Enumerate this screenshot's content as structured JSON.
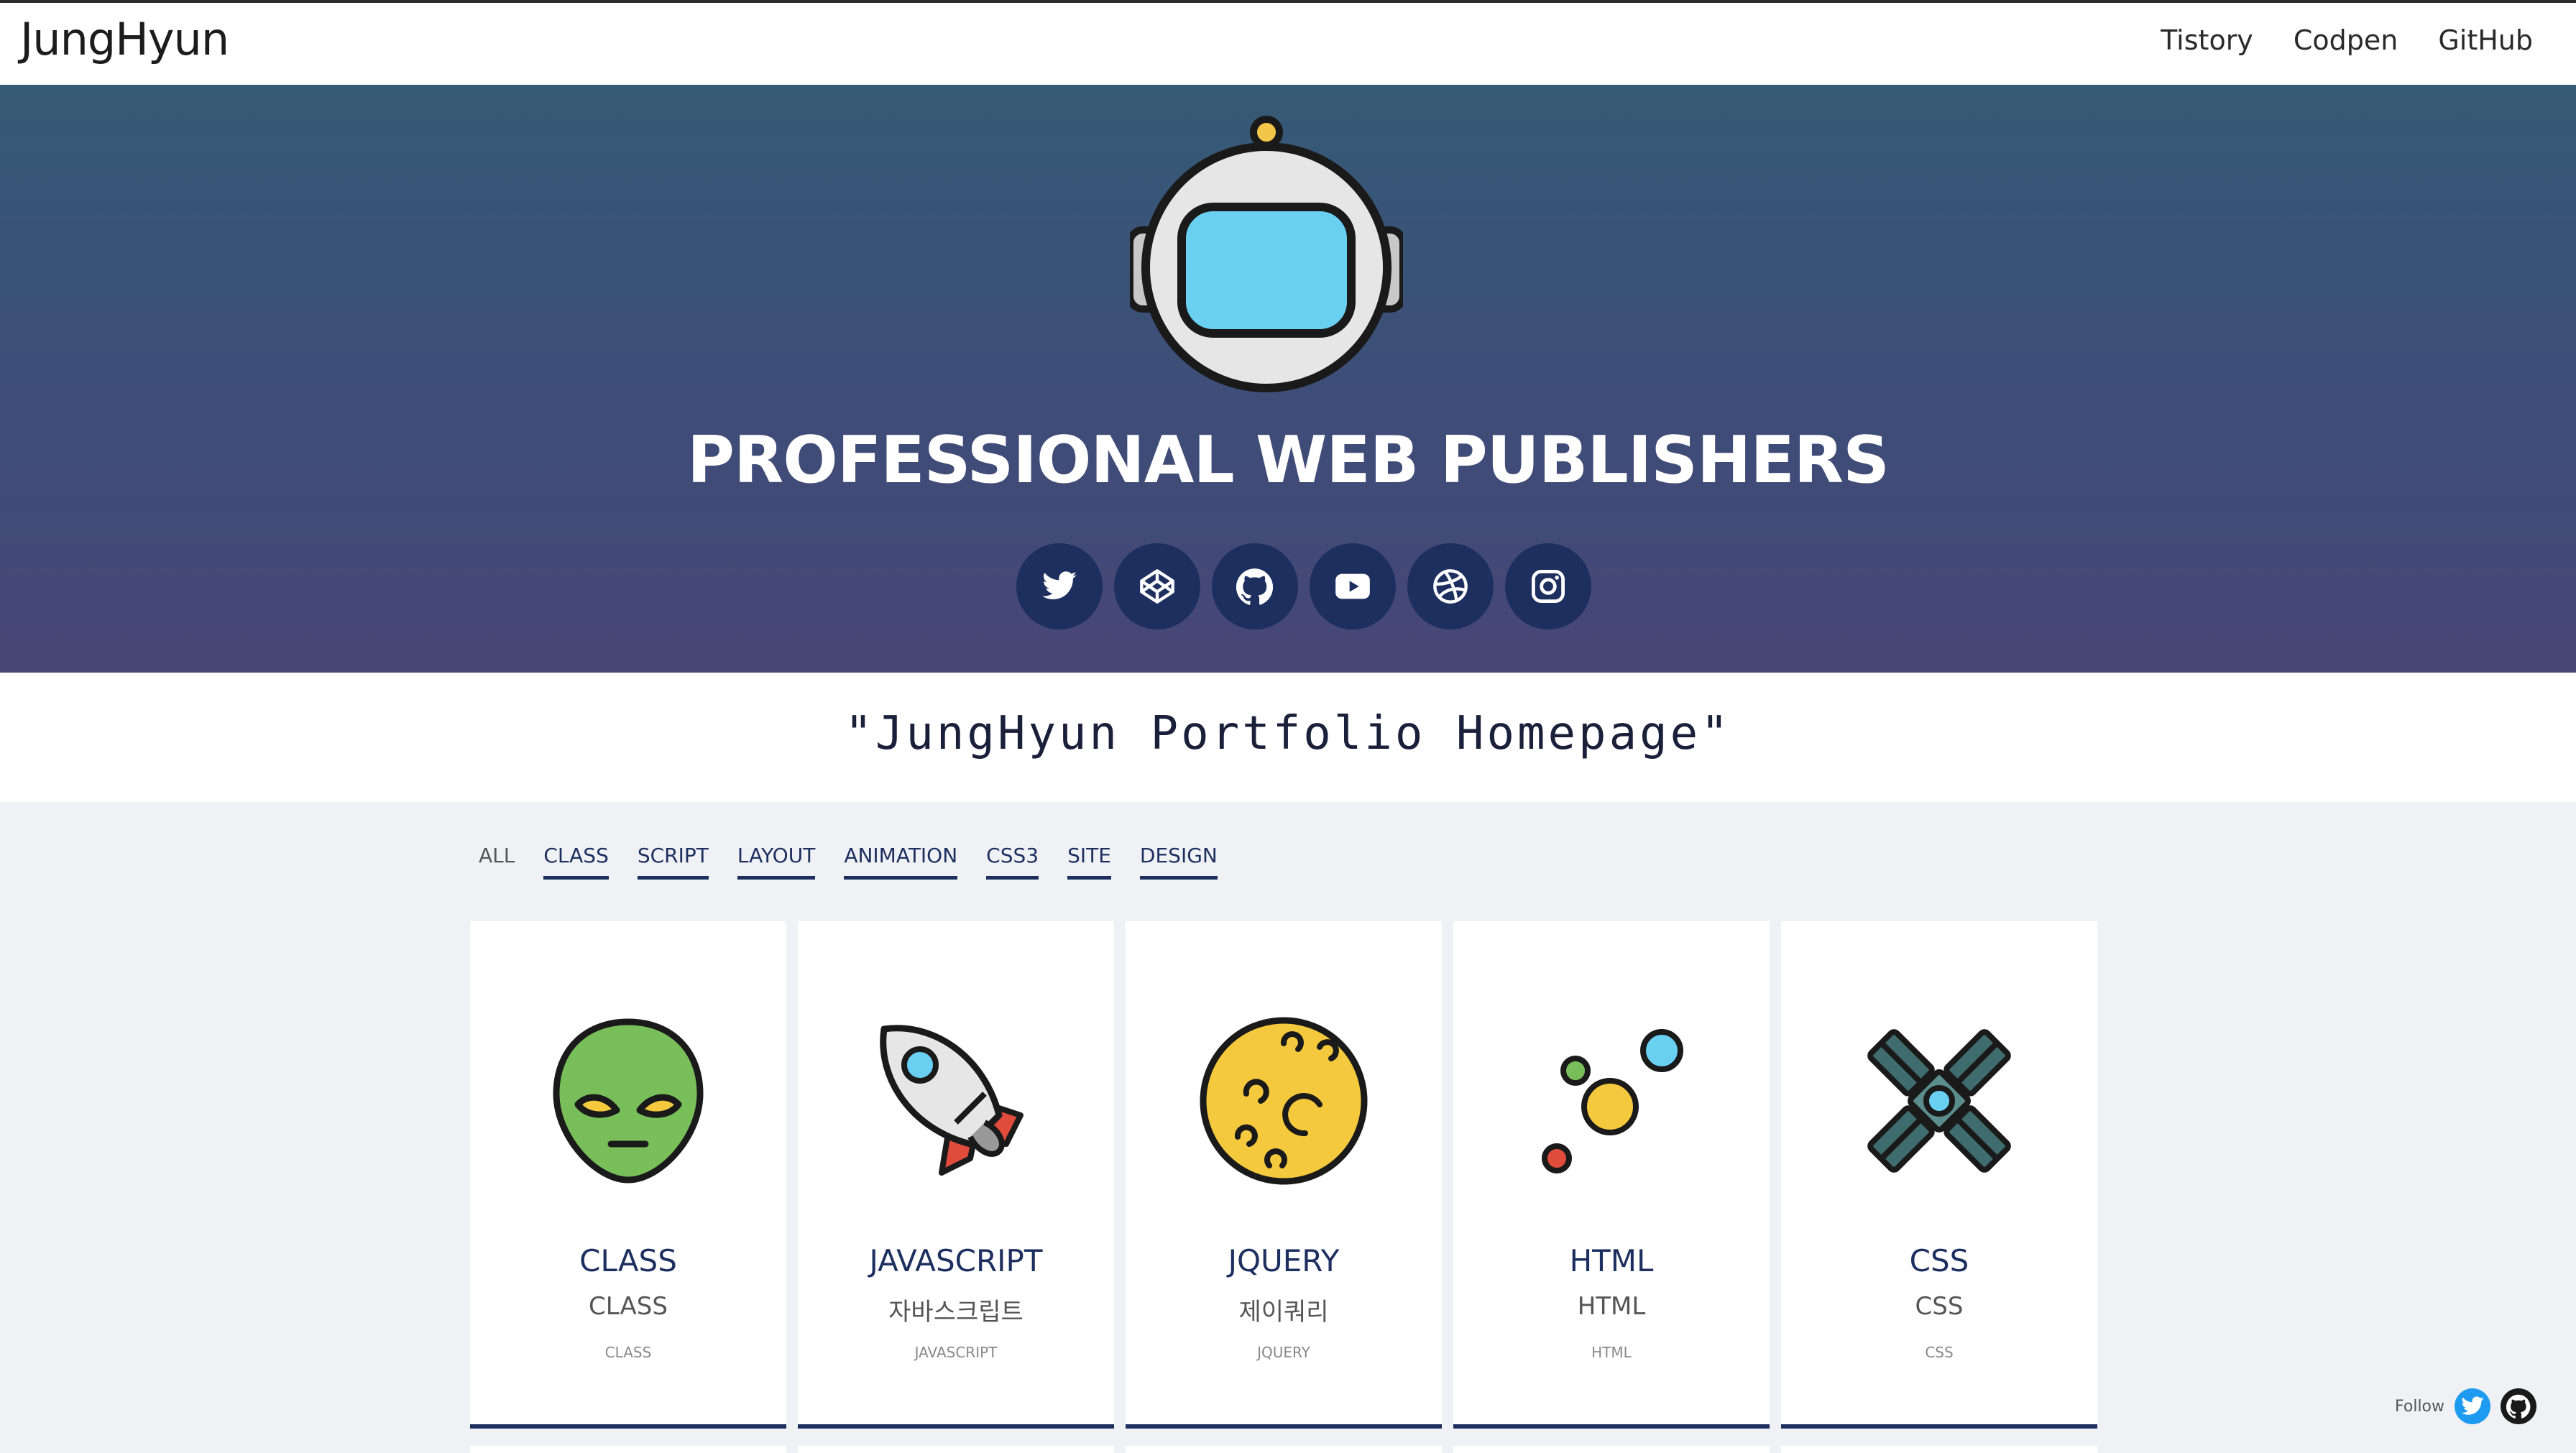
{
  "header": {
    "brand": "JungHyun",
    "nav": [
      "Tistory",
      "Codpen",
      "GitHub"
    ]
  },
  "hero": {
    "title": "PROFESSIONAL WEB PUBLISHERS",
    "socials": [
      "twitter-icon",
      "codepen-icon",
      "github-icon",
      "youtube-icon",
      "dribbble-icon",
      "instagram-icon"
    ],
    "colors": {
      "gradient_top": "#355a76",
      "gradient_bottom": "#474675",
      "social_bg": "#1d2f5f"
    }
  },
  "tagline": "\"JungHyun Portfolio Homepage\"",
  "filters": [
    "ALL",
    "CLASS",
    "SCRIPT",
    "LAYOUT",
    "ANIMATION",
    "CSS3",
    "SITE",
    "DESIGN"
  ],
  "cards": [
    {
      "icon": "alien-icon",
      "title": "CLASS",
      "subtitle": "CLASS",
      "caption": "CLASS"
    },
    {
      "icon": "rocket-icon",
      "title": "JAVASCRIPT",
      "subtitle": "자바스크립트",
      "caption": "JAVASCRIPT"
    },
    {
      "icon": "moon-icon",
      "title": "JQUERY",
      "subtitle": "제이쿼리",
      "caption": "JQUERY"
    },
    {
      "icon": "planets-icon",
      "title": "HTML",
      "subtitle": "HTML",
      "caption": "HTML"
    },
    {
      "icon": "satellite-icon",
      "title": "CSS",
      "subtitle": "CSS",
      "caption": "CSS"
    }
  ],
  "follow": {
    "label": "Follow",
    "icons": [
      "twitter-icon",
      "github-icon"
    ]
  }
}
